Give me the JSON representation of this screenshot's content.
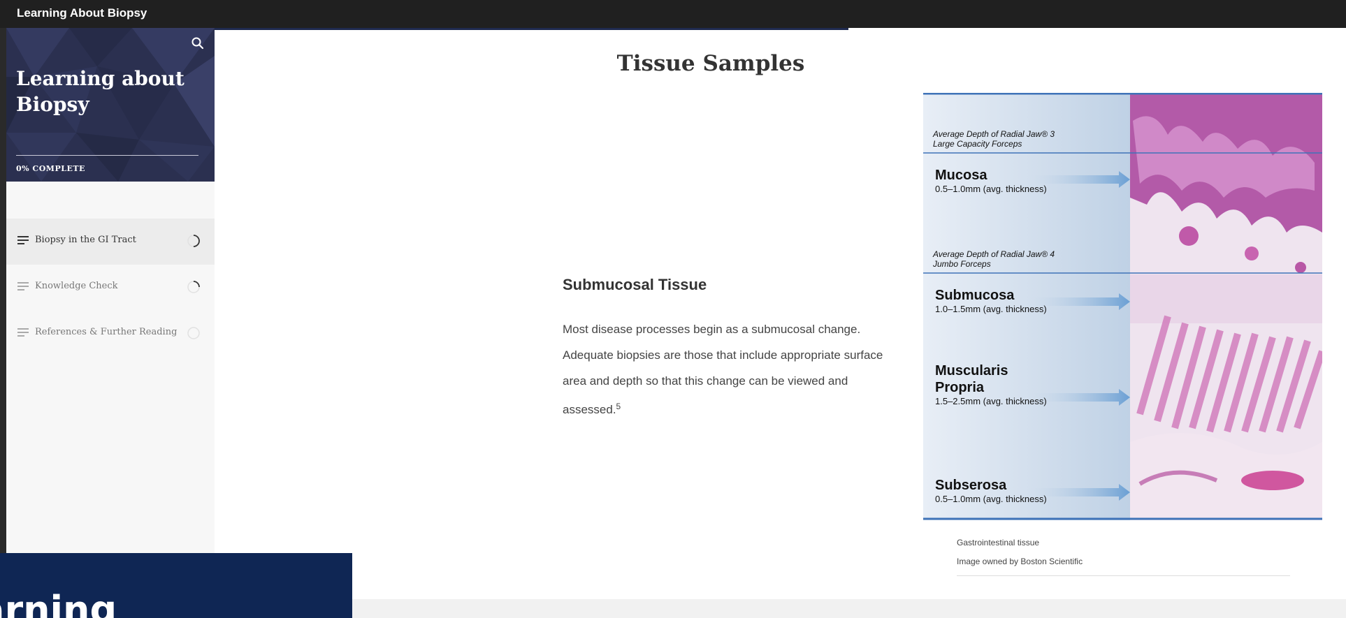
{
  "topbar": {
    "title": "Learning About Biopsy"
  },
  "sidebar": {
    "course_title": "Learning about Biopsy",
    "progress_label": "0% COMPLETE",
    "items": [
      {
        "label": "Biopsy in the GI Tract",
        "status": "in-progress"
      },
      {
        "label": "Knowledge Check",
        "status": "in-progress"
      },
      {
        "label": "References & Further Reading",
        "status": "not-started"
      }
    ]
  },
  "main": {
    "title": "Tissue Samples",
    "section_heading": "Submucosal Tissue",
    "paragraph": "Most disease processes begin as a submucosal change. Adequate biopsies are those that include appropriate surface area and depth so that this change can be viewed and assessed.",
    "footnote": "5"
  },
  "figure": {
    "depth_markers": [
      {
        "line1": "Average Depth of Radial Jaw® 3",
        "line2": "Large Capacity Forceps"
      },
      {
        "line1": "Average Depth of Radial Jaw® 4",
        "line2": "Jumbo Forceps"
      }
    ],
    "layers": [
      {
        "name": "Mucosa",
        "name2": "",
        "thickness": "0.5–1.0mm (avg. thickness)"
      },
      {
        "name": "Submucosa",
        "name2": "",
        "thickness": "1.0–1.5mm (avg. thickness)"
      },
      {
        "name": "Muscularis",
        "name2": "Propria",
        "thickness": "1.5–2.5mm (avg. thickness)"
      },
      {
        "name": "Subserosa",
        "name2": "",
        "thickness": "0.5–1.0mm (avg. thickness)"
      }
    ],
    "caption_line1": "Gastrointestinal tissue",
    "caption_line2": "Image owned by Boston Scientific"
  },
  "overlay": {
    "text": "arning"
  },
  "colors": {
    "topbar": "#202020",
    "sidebar_header": "#2b3050",
    "overlay_box": "#0f2654",
    "figure_panel": "#cfdcea",
    "tissue_pink": "#d8a6cf"
  },
  "icons": {
    "search": "search-icon",
    "menu": "menu-lines-icon",
    "progress_ring": "progress-ring-icon"
  }
}
